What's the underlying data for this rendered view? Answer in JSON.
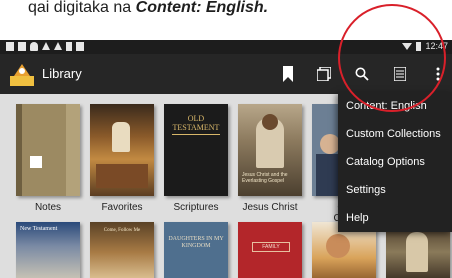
{
  "caption": {
    "prefix": "qai digitaka na ",
    "emphasis": "Content: English."
  },
  "statusbar": {
    "time": "12:47"
  },
  "appbar": {
    "title": "Library"
  },
  "library": {
    "row1": [
      {
        "label": "Notes"
      },
      {
        "label": "Favorites"
      },
      {
        "label": "Scriptures",
        "cover_text": "OLD TESTAMENT"
      },
      {
        "label": "Jesus Christ",
        "cover_text": "Jesus Christ and the Everlasting Gospel"
      },
      {
        "label": "Ge",
        "label2": "Conf"
      }
    ],
    "row2": [
      {
        "cover_text": "New Testament"
      },
      {
        "cover_text": "Come, Follow Me"
      },
      {
        "cover_text": "DAUGHTERS IN MY KINGDOM"
      },
      {
        "cover_text": "FAMILY"
      },
      {},
      {}
    ]
  },
  "menu": {
    "items": [
      {
        "label": "Content: English"
      },
      {
        "label": "Custom Collections"
      },
      {
        "label": "Catalog Options"
      },
      {
        "label": "Settings"
      },
      {
        "label": "Help"
      }
    ]
  },
  "colors": {
    "accent_ring": "#d9202a",
    "appbar": "#262626",
    "menu_bg": "#222222"
  }
}
